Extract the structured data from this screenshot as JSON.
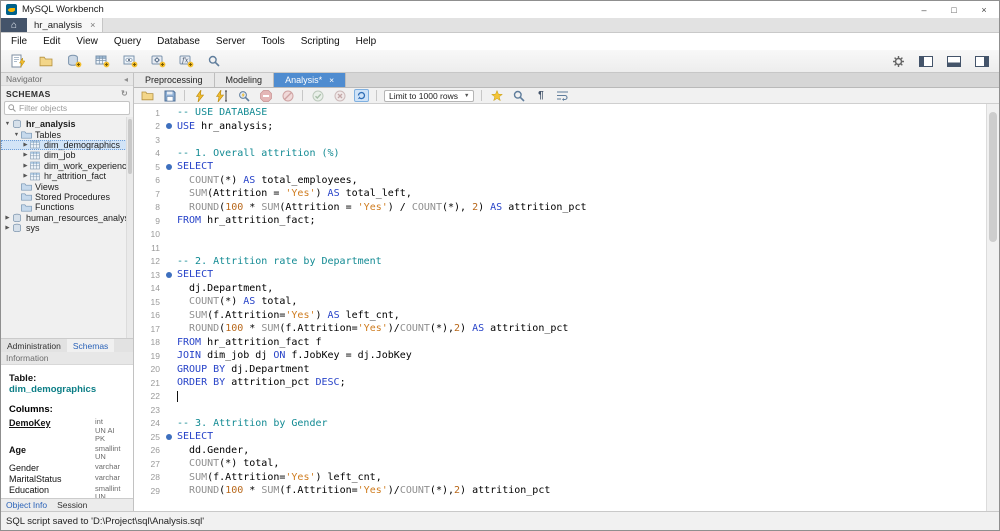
{
  "window": {
    "title": "MySQL Workbench",
    "controls": [
      {
        "name": "minimize-button",
        "glyph": "–"
      },
      {
        "name": "maximize-button",
        "glyph": "□"
      },
      {
        "name": "close-button",
        "glyph": "×"
      }
    ]
  },
  "doc_tabs": {
    "home_glyph": "⌂",
    "tabs": [
      {
        "label": "hr_analysis",
        "close_glyph": "×",
        "active": true
      }
    ]
  },
  "menu": {
    "items": [
      "File",
      "Edit",
      "View",
      "Query",
      "Database",
      "Server",
      "Tools",
      "Scripting",
      "Help"
    ]
  },
  "toolbar_main": {
    "left": [
      {
        "name": "new-query-tab-icon",
        "glyph": "page_bolt"
      },
      {
        "name": "open-sql-script-icon",
        "glyph": "folder"
      },
      {
        "name": "create-schema-icon",
        "glyph": "db_plus"
      },
      {
        "name": "create-table-icon",
        "glyph": "table_plus"
      },
      {
        "name": "create-view-icon",
        "glyph": "view_plus"
      },
      {
        "name": "create-procedure-icon",
        "glyph": "proc_plus"
      },
      {
        "name": "create-function-icon",
        "glyph": "func_plus"
      },
      {
        "name": "search-data-icon",
        "glyph": "magnifier"
      }
    ],
    "right": [
      {
        "name": "preferences-gear-icon",
        "glyph": "gear"
      },
      {
        "name": "toggle-left-panel-icon",
        "glyph": "panel_left"
      },
      {
        "name": "toggle-bottom-panel-icon",
        "glyph": "panel_bottom"
      },
      {
        "name": "toggle-right-panel-icon",
        "glyph": "panel_right"
      }
    ]
  },
  "navigator": {
    "panel_title": "Navigator",
    "section_title": "SCHEMAS",
    "filter_placeholder": "Filter objects",
    "tree": [
      {
        "label": "hr_analysis",
        "level": 0,
        "exp": "open",
        "icon": "schema",
        "bold": true
      },
      {
        "label": "Tables",
        "level": 1,
        "exp": "open",
        "icon": "folder"
      },
      {
        "label": "dim_demographics",
        "level": 2,
        "exp": "closed",
        "icon": "table",
        "selected": true
      },
      {
        "label": "dim_job",
        "level": 2,
        "exp": "closed",
        "icon": "table"
      },
      {
        "label": "dim_work_experience",
        "level": 2,
        "exp": "closed",
        "icon": "table"
      },
      {
        "label": "hr_attrition_fact",
        "level": 2,
        "exp": "closed",
        "icon": "table"
      },
      {
        "label": "Views",
        "level": 1,
        "exp": "none",
        "icon": "folder"
      },
      {
        "label": "Stored Procedures",
        "level": 1,
        "exp": "none",
        "icon": "folder"
      },
      {
        "label": "Functions",
        "level": 1,
        "exp": "none",
        "icon": "folder"
      },
      {
        "label": "human_resources_analysis",
        "level": 0,
        "exp": "closed",
        "icon": "schema"
      },
      {
        "label": "sys",
        "level": 0,
        "exp": "closed",
        "icon": "schema"
      }
    ],
    "bottom_tabs": [
      {
        "label": "Administration",
        "active": false
      },
      {
        "label": "Schemas",
        "active": true
      }
    ]
  },
  "information": {
    "panel_title": "Information",
    "table_label": "Table:",
    "table_name": "dim_demographics",
    "columns_label": "Columns:",
    "columns": [
      {
        "name": "DemoKey",
        "style": "pk",
        "types": [
          "int",
          "UN AI",
          "PK"
        ]
      },
      {
        "name": "Age",
        "style": "bold",
        "types": [
          "smallint",
          "UN"
        ]
      },
      {
        "name": "Gender",
        "style": "plain",
        "types": [
          "varchar"
        ]
      },
      {
        "name": "MaritalStatus",
        "style": "plain",
        "types": [
          "varchar"
        ]
      },
      {
        "name": "Education",
        "style": "plain",
        "types": [
          "smallint",
          "UN"
        ]
      }
    ]
  },
  "sidebar_footer_tabs": [
    {
      "label": "Object Info",
      "active": true
    },
    {
      "label": "Session",
      "active": false
    }
  ],
  "editor": {
    "tabs": [
      {
        "label": "Preprocessing",
        "active": false
      },
      {
        "label": "Modeling",
        "active": false
      },
      {
        "label": "Analysis*",
        "active": true,
        "close_glyph": "×"
      }
    ],
    "toolbar": {
      "items": [
        {
          "name": "open-script-icon",
          "glyph": "folder_sm"
        },
        {
          "name": "save-script-icon",
          "glyph": "floppy"
        },
        {
          "sep": true
        },
        {
          "name": "execute-icon",
          "glyph": "bolt"
        },
        {
          "name": "execute-current-statement-icon",
          "glyph": "bolt_cursor"
        },
        {
          "name": "explain-icon",
          "glyph": "explain"
        },
        {
          "name": "stop-icon",
          "glyph": "stop"
        },
        {
          "name": "toggle-stop-on-error-icon",
          "glyph": "stop_err"
        },
        {
          "sep": true
        },
        {
          "name": "commit-icon",
          "glyph": "commit"
        },
        {
          "name": "rollback-icon",
          "glyph": "rollback"
        },
        {
          "name": "toggle-autocommit-icon",
          "glyph": "autocommit",
          "active": true
        },
        {
          "sep": true
        },
        {
          "dropdown": true,
          "name": "row-limit-select",
          "label": "Limit to 1000 rows"
        },
        {
          "sep": true
        },
        {
          "name": "save-snippet-icon",
          "glyph": "snippet_star"
        },
        {
          "name": "find-icon",
          "glyph": "magnifier"
        },
        {
          "name": "toggle-invisibles-icon",
          "glyph": "pilcrow"
        },
        {
          "name": "toggle-wrap-icon",
          "glyph": "wrap"
        }
      ]
    },
    "code": {
      "lines": [
        {
          "n": 1,
          "t": [
            [
              "cm",
              "-- USE DATABASE"
            ]
          ]
        },
        {
          "n": 2,
          "m": true,
          "t": [
            [
              "kw",
              "USE"
            ],
            [
              "pl",
              " hr_analysis;"
            ]
          ]
        },
        {
          "n": 3,
          "t": []
        },
        {
          "n": 4,
          "t": [
            [
              "cm",
              "-- 1. Overall attrition (%)"
            ]
          ]
        },
        {
          "n": 5,
          "m": true,
          "t": [
            [
              "kw",
              "SELECT"
            ]
          ]
        },
        {
          "n": 6,
          "t": [
            [
              "pl",
              "  "
            ],
            [
              "fn",
              "COUNT"
            ],
            [
              "pl",
              "(*) "
            ],
            [
              "kw",
              "AS"
            ],
            [
              "pl",
              " total_employees,"
            ]
          ]
        },
        {
          "n": 7,
          "t": [
            [
              "pl",
              "  "
            ],
            [
              "fn",
              "SUM"
            ],
            [
              "pl",
              "(Attrition = "
            ],
            [
              "st",
              "'Yes'"
            ],
            [
              "pl",
              ") "
            ],
            [
              "kw",
              "AS"
            ],
            [
              "pl",
              " total_left,"
            ]
          ]
        },
        {
          "n": 8,
          "t": [
            [
              "pl",
              "  "
            ],
            [
              "fn",
              "ROUND"
            ],
            [
              "pl",
              "("
            ],
            [
              "nu",
              "100"
            ],
            [
              "pl",
              " * "
            ],
            [
              "fn",
              "SUM"
            ],
            [
              "pl",
              "(Attrition = "
            ],
            [
              "st",
              "'Yes'"
            ],
            [
              "pl",
              ") / "
            ],
            [
              "fn",
              "COUNT"
            ],
            [
              "pl",
              "(*), "
            ],
            [
              "nu",
              "2"
            ],
            [
              "pl",
              ") "
            ],
            [
              "kw",
              "AS"
            ],
            [
              "pl",
              " attrition_pct"
            ]
          ]
        },
        {
          "n": 9,
          "t": [
            [
              "kw",
              "FROM"
            ],
            [
              "pl",
              " hr_attrition_fact;"
            ]
          ]
        },
        {
          "n": 10,
          "t": []
        },
        {
          "n": 11,
          "t": []
        },
        {
          "n": 12,
          "t": [
            [
              "cm",
              "-- 2. Attrition rate by Department"
            ]
          ]
        },
        {
          "n": 13,
          "m": true,
          "t": [
            [
              "kw",
              "SELECT"
            ]
          ]
        },
        {
          "n": 14,
          "t": [
            [
              "pl",
              "  dj.Department,"
            ]
          ]
        },
        {
          "n": 15,
          "t": [
            [
              "pl",
              "  "
            ],
            [
              "fn",
              "COUNT"
            ],
            [
              "pl",
              "(*) "
            ],
            [
              "kw",
              "AS"
            ],
            [
              "pl",
              " total,"
            ]
          ]
        },
        {
          "n": 16,
          "t": [
            [
              "pl",
              "  "
            ],
            [
              "fn",
              "SUM"
            ],
            [
              "pl",
              "(f.Attrition="
            ],
            [
              "st",
              "'Yes'"
            ],
            [
              "pl",
              ") "
            ],
            [
              "kw",
              "AS"
            ],
            [
              "pl",
              " left_cnt,"
            ]
          ]
        },
        {
          "n": 17,
          "t": [
            [
              "pl",
              "  "
            ],
            [
              "fn",
              "ROUND"
            ],
            [
              "pl",
              "("
            ],
            [
              "nu",
              "100"
            ],
            [
              "pl",
              " * "
            ],
            [
              "fn",
              "SUM"
            ],
            [
              "pl",
              "(f.Attrition="
            ],
            [
              "st",
              "'Yes'"
            ],
            [
              "pl",
              ")/"
            ],
            [
              "fn",
              "COUNT"
            ],
            [
              "pl",
              "(*),"
            ],
            [
              "nu",
              "2"
            ],
            [
              "pl",
              ") "
            ],
            [
              "kw",
              "AS"
            ],
            [
              "pl",
              " attrition_pct"
            ]
          ]
        },
        {
          "n": 18,
          "t": [
            [
              "kw",
              "FROM"
            ],
            [
              "pl",
              " hr_attrition_fact f"
            ]
          ]
        },
        {
          "n": 19,
          "t": [
            [
              "kw",
              "JOIN"
            ],
            [
              "pl",
              " dim_job dj "
            ],
            [
              "kw",
              "ON"
            ],
            [
              "pl",
              " f.JobKey = dj.JobKey"
            ]
          ]
        },
        {
          "n": 20,
          "t": [
            [
              "kw",
              "GROUP BY"
            ],
            [
              "pl",
              " dj.Department"
            ]
          ]
        },
        {
          "n": 21,
          "t": [
            [
              "kw",
              "ORDER BY"
            ],
            [
              "pl",
              " attrition_pct "
            ],
            [
              "kw",
              "DESC"
            ],
            [
              "pl",
              ";"
            ]
          ]
        },
        {
          "n": 22,
          "cursor": true,
          "t": []
        },
        {
          "n": 23,
          "t": []
        },
        {
          "n": 24,
          "t": [
            [
              "cm",
              "-- 3. Attrition by Gender"
            ]
          ]
        },
        {
          "n": 25,
          "m": true,
          "t": [
            [
              "kw",
              "SELECT"
            ]
          ]
        },
        {
          "n": 26,
          "t": [
            [
              "pl",
              "  dd.Gender,"
            ]
          ]
        },
        {
          "n": 27,
          "t": [
            [
              "pl",
              "  "
            ],
            [
              "fn",
              "COUNT"
            ],
            [
              "pl",
              "(*) total,"
            ]
          ]
        },
        {
          "n": 28,
          "t": [
            [
              "pl",
              "  "
            ],
            [
              "fn",
              "SUM"
            ],
            [
              "pl",
              "(f.Attrition="
            ],
            [
              "st",
              "'Yes'"
            ],
            [
              "pl",
              ") left_cnt,"
            ]
          ]
        },
        {
          "n": 29,
          "t": [
            [
              "pl",
              "  "
            ],
            [
              "fn",
              "ROUND"
            ],
            [
              "pl",
              "("
            ],
            [
              "nu",
              "100"
            ],
            [
              "pl",
              " * "
            ],
            [
              "fn",
              "SUM"
            ],
            [
              "pl",
              "(f.Attrition="
            ],
            [
              "st",
              "'Yes'"
            ],
            [
              "pl",
              ")/"
            ],
            [
              "fn",
              "COUNT"
            ],
            [
              "pl",
              "(*),"
            ],
            [
              "nu",
              "2"
            ],
            [
              "pl",
              ") attrition_pct"
            ]
          ]
        }
      ]
    }
  },
  "status_bar": {
    "text": "SQL script saved to 'D:\\Project\\sql\\Analysis.sql'"
  }
}
